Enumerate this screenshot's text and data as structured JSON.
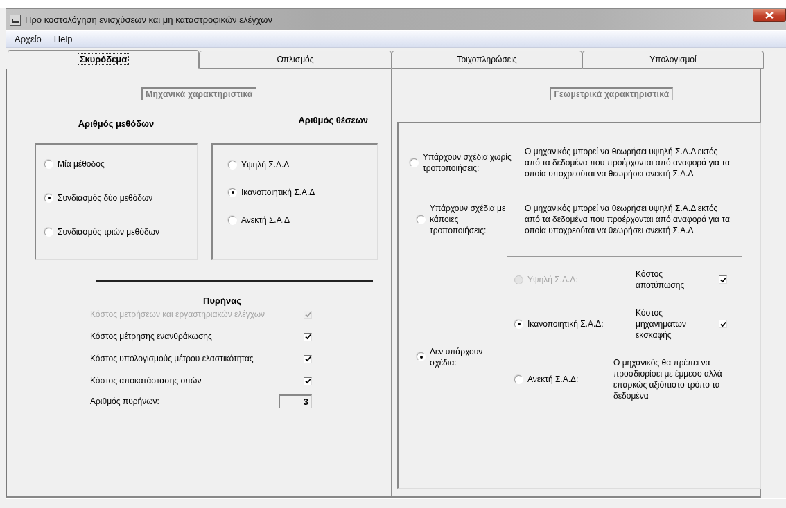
{
  "window": {
    "title": "Προ κοστολόγηση ενισχύσεων και μη καταστροφικών ελέγχων"
  },
  "menu": [
    "Αρχείο",
    "Help"
  ],
  "tabs": [
    {
      "label": "Σκυρόδεμα",
      "selected": true
    },
    {
      "label": "Οπλισμός",
      "selected": false
    },
    {
      "label": "Τοιχοπληρώσεις",
      "selected": false
    },
    {
      "label": "Υπολογισμοί",
      "selected": false
    }
  ],
  "mechanical": {
    "title": "Μηχανικά χαρακτηριστικά",
    "methods": {
      "heading": "Αριθμός μεθόδων",
      "options": [
        {
          "label": "Μία μέθοδος",
          "selected": false
        },
        {
          "label": "Συνδιασμός δύο μεθόδων",
          "selected": true
        },
        {
          "label": "Συνδιασμός τριών μεθόδων",
          "selected": false
        }
      ]
    },
    "positions": {
      "heading": "Αριθμός θέσεων",
      "options": [
        {
          "label": "Υψηλή Σ.Α.Δ",
          "selected": false
        },
        {
          "label": "Ικανοποιητική Σ.Α.Δ",
          "selected": true
        },
        {
          "label": "Ανεκτή Σ.Α.Δ",
          "selected": false
        }
      ]
    },
    "core": {
      "heading": "Πυρήνας",
      "costs": [
        {
          "label": "Κόστος μετρήσεων και εργαστηριακών ελέγχων",
          "checked": true,
          "disabled": true
        },
        {
          "label": "Κόστος μέτρησης ενανθράκωσης",
          "checked": true,
          "disabled": false
        },
        {
          "label": "Κόστος υπολογισμούς μέτρου ελαστικότητας",
          "checked": true,
          "disabled": false
        },
        {
          "label": "Κόστος αποκατάστασης οπών",
          "checked": true,
          "disabled": false
        }
      ],
      "count": {
        "label": "Αριθμός πυρήνων:",
        "value": "3"
      }
    }
  },
  "geometric": {
    "title": "Γεωμετρικά χαρακτηριστικά",
    "plans": [
      {
        "kind": "text",
        "label": "Υπάρχουν σχέδια χωρίς τροποποιήσεις:",
        "selected": false,
        "description": "Ο μηχανικός μπορεί να θεωρήσει υψηλή Σ.Α.Δ εκτός από τα δεδομένα που προέρχονται από αναφορά για τα οποία υποχρεούται να θεωρήσει ανεκτή Σ.Α.Δ"
      },
      {
        "kind": "text",
        "label": "Υπάρχουν σχέδια με κάποιες τροποποιήσεις:",
        "selected": false,
        "description": "Ο μηχανικός μπορεί να θεωρήσει υψηλή Σ.Α.Δ εκτός από τα δεδομένα που προέρχονται από αναφορά για τα οποία υποχρεούται να θεωρήσει ανεκτή Σ.Α.Δ"
      },
      {
        "kind": "levels",
        "label": "Δεν υπάρχουν σχέδια:",
        "selected": true,
        "levels": [
          {
            "kind": "cost",
            "label": "Υψηλή Σ.Α.Δ:",
            "selected": false,
            "disabled": true,
            "cost": {
              "label": "Κόστος αποτύπωσης",
              "checked": true
            }
          },
          {
            "kind": "cost",
            "label": "Ικανοποιητική Σ.Α.Δ:",
            "selected": true,
            "disabled": false,
            "cost": {
              "label": "Κόστος μηχανημάτων εκσκαφής",
              "checked": true
            }
          },
          {
            "kind": "note",
            "label": "Ανεκτή Σ.Α.Δ:",
            "selected": false,
            "disabled": false,
            "note": "Ο μηχανικός θα πρέπει να προσδιορίσει με έμμεσο αλλά επαρκώς αξιόπιστο τρόπο τα δεδομένα"
          }
        ]
      }
    ]
  }
}
